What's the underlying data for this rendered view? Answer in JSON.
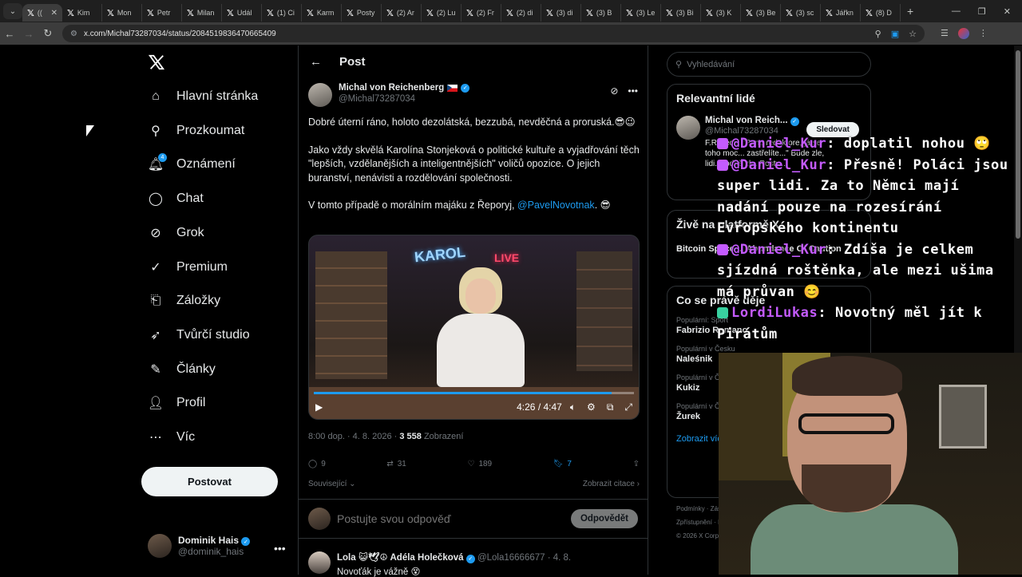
{
  "browser": {
    "tabs": [
      {
        "label": "(("
      },
      {
        "label": "Kim"
      },
      {
        "label": "Mon"
      },
      {
        "label": "Petr"
      },
      {
        "label": "Milan"
      },
      {
        "label": "Udál"
      },
      {
        "label": "(1) Ci"
      },
      {
        "label": "Karm"
      },
      {
        "label": "Posty"
      },
      {
        "label": "(2) Ar"
      },
      {
        "label": "(2) Lu"
      },
      {
        "label": "(2) Fr"
      },
      {
        "label": "(2) di"
      },
      {
        "label": "(3) di"
      },
      {
        "label": "(3) B"
      },
      {
        "label": "(3) Le"
      },
      {
        "label": "(3) Bi"
      },
      {
        "label": "(3) K"
      },
      {
        "label": "(3) Be"
      },
      {
        "label": "(3) sc"
      },
      {
        "label": "Jářkn"
      },
      {
        "label": "(8) D"
      }
    ],
    "url": "x.com/Michal73287034/status/2084519836470665409"
  },
  "nav": {
    "items": [
      {
        "label": "Hlavní stránka",
        "icon": "home-icon"
      },
      {
        "label": "Prozkoumat",
        "icon": "search-icon"
      },
      {
        "label": "Oznámení",
        "icon": "bell-icon",
        "badge": "4"
      },
      {
        "label": "Chat",
        "icon": "chat-icon"
      },
      {
        "label": "Grok",
        "icon": "grok-icon"
      },
      {
        "label": "Premium",
        "icon": "premium-icon"
      },
      {
        "label": "Záložky",
        "icon": "bookmark-icon"
      },
      {
        "label": "Tvůrčí studio",
        "icon": "rocket-icon"
      },
      {
        "label": "Články",
        "icon": "article-icon"
      },
      {
        "label": "Profil",
        "icon": "person-icon"
      },
      {
        "label": "Víc",
        "icon": "more-icon"
      }
    ],
    "post_button": "Postovat",
    "me": {
      "name": "Dominik Hais",
      "handle": "@dominik_hais"
    }
  },
  "main": {
    "header_title": "Post",
    "author": {
      "name": "Michal von Reichenberg",
      "handle": "@Michal73287034"
    },
    "text_1": "Dobré úterní ráno, holoto dezolátská, bezzubá, nevděčná a proruská.😎😉",
    "text_2": "Jako vždy skvělá Karolína Stonjeková o politické kultuře a vyjadřování těch \"lepších, vzdělanějších a inteligentnějších\" voličů opozice. O jejich buranství, nenávisti a rozdělování společnosti.",
    "text_3_prefix": "V tomto případě o morálním majáku z Řeporyj, ",
    "text_3_mention": "@PavelNovotnak",
    "text_3_suffix": ". 😎",
    "video": {
      "neon_1": "KAROL",
      "neon_2": "LIVE",
      "time": "4:26 / 4:47",
      "progress_fraction": 0.93
    },
    "meta_time": "8:00 dop. · 4. 8. 2026 · ",
    "meta_views": "3 558",
    "meta_views_label": " Zobrazení",
    "actions": {
      "replies": "9",
      "reposts": "31",
      "likes": "189",
      "bookmarks": "7"
    },
    "related_label": "Související",
    "quotes_label": "Zobrazit citace",
    "reply_placeholder": "Postujte svou odpověď",
    "reply_button": "Odpovědět",
    "next_post": {
      "name": "Lola 😺🕊☮ Adéla Holečková",
      "handle": "@Lola16666677 · 4. 8.",
      "text": "Novoťák je vážně 😵"
    }
  },
  "sidebar": {
    "search_placeholder": "Vyhledávání",
    "relevant_title": "Relevantní lidé",
    "relevant": {
      "name": "Michal von Reich...",
      "handle": "@Michal73287034",
      "bio": "F.R.Čech: \"Pane redaktore, já se toho moc... zastřelíte...\" Bude zle, lidi. Hodně zle. Posty...",
      "follow": "Sledovat"
    },
    "live_title": "Živě na platformě X",
    "live_item": "Bitcoin Space ... Abundance Of Caution",
    "trends_title": "Co se právě děje",
    "trends": [
      {
        "category": "Populární: Sport",
        "name": "Fabrizio Romano"
      },
      {
        "category": "Populární v Česku",
        "name": "Naleśnik"
      },
      {
        "category": "Populární v Česku",
        "name": "Kukiz"
      },
      {
        "category": "Populární v Česku",
        "name": "Žurek"
      }
    ],
    "show_more": "Zobrazit více",
    "footer": [
      "Podmínky · Zásady ochrany",
      "Zpřístupnění · Informace",
      "© 2026 X Corp."
    ]
  },
  "chat_overlay": [
    {
      "user": "@Daniel_Kur",
      "text": ": doplatil nohou 🙄"
    },
    {
      "user": "@Daniel_Kur",
      "text": ": Přesně! Poláci jsou super lidi. Za to Němci mají nadání pouze na rozesírání Evropského kontinentu"
    },
    {
      "user": "@Daniel_Kur",
      "text": ": Zdíša je celkem sjízdná roštěnka, ale mezi ušima má průvan 😊"
    },
    {
      "user": "LordiLukas",
      "text": ": Novotný měl jít k Pirátům"
    }
  ]
}
